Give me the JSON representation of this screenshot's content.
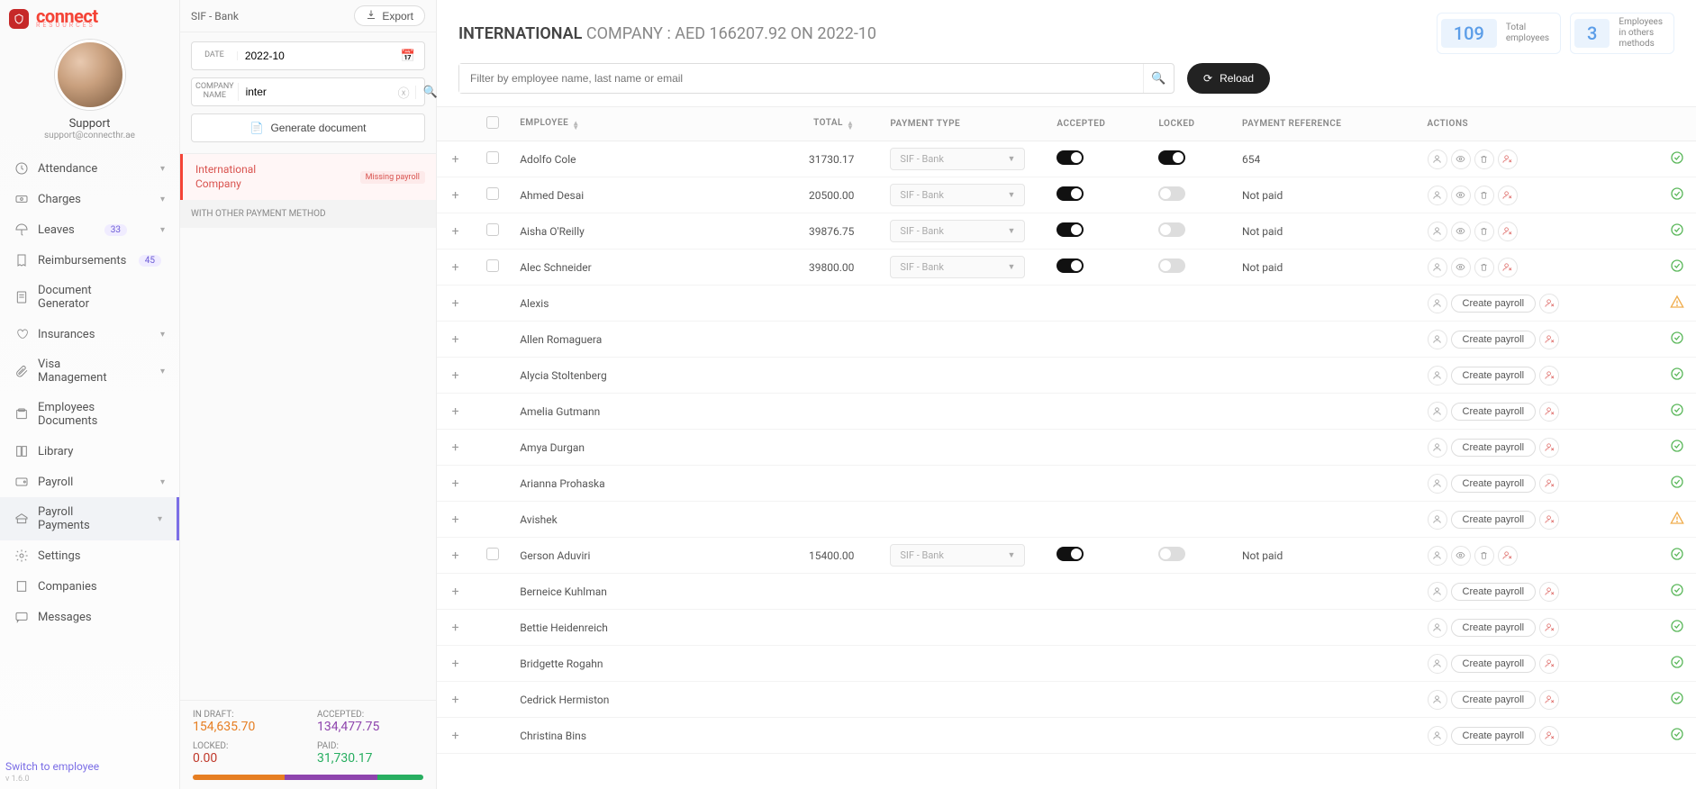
{
  "brand": {
    "name": "connect",
    "sub": "RESOURCES"
  },
  "user": {
    "name": "Support",
    "email": "support@connecthr.ae"
  },
  "nav": {
    "attendance": "Attendance",
    "charges": "Charges",
    "leaves": "Leaves",
    "leaves_badge": "33",
    "reimbursements": "Reimbursements",
    "reimb_badge": "45",
    "docgen1": "Document",
    "docgen2": "Generator",
    "insurances": "Insurances",
    "visa1": "Visa",
    "visa2": "Management",
    "empdoc1": "Employees",
    "empdoc2": "Documents",
    "library": "Library",
    "payroll": "Payroll",
    "pp1": "Payroll",
    "pp2": "Payments",
    "settings": "Settings",
    "companies": "Companies",
    "messages": "Messages"
  },
  "switch_link": "Switch to employee",
  "version": "v 1.6.0",
  "filter": {
    "title": "SIF - Bank",
    "export": "Export",
    "date_label": "DATE",
    "date_value": "2022-10",
    "company_label1": "COMPANY",
    "company_label2": "NAME",
    "company_value": "inter",
    "gen_doc": "Generate document",
    "company_card1": "International",
    "company_card2": "Company",
    "missing": "Missing payroll",
    "other_method": "WITH OTHER PAYMENT METHOD"
  },
  "footer_stats": {
    "draft_label": "IN DRAFT:",
    "draft_value": "154,635.70",
    "accepted_label": "ACCEPTED:",
    "accepted_value": "134,477.75",
    "locked_label": "LOCKED:",
    "locked_value": "0.00",
    "paid_label": "PAID:",
    "paid_value": "31,730.17"
  },
  "header": {
    "title_bold": "INTERNATIONAL",
    "title_rest": " COMPANY : AED 166207.92 ON 2022-10",
    "stat1_num": "109",
    "stat1_lbl1": "Total",
    "stat1_lbl2": "employees",
    "stat2_num": "3",
    "stat2_lbl1": "Employees",
    "stat2_lbl2": "in others",
    "stat2_lbl3": "methods"
  },
  "toolbar": {
    "search_placeholder": "Filter by employee name, last name or email",
    "reload": "Reload"
  },
  "columns": {
    "employee": "EMPLOYEE",
    "total": "TOTAL",
    "ptype": "PAYMENT TYPE",
    "accepted": "ACCEPTED",
    "locked": "LOCKED",
    "ref": "PAYMENT REFERENCE",
    "actions": "ACTIONS"
  },
  "ptype_value": "SIF - Bank",
  "not_paid": "Not paid",
  "create_payroll": "Create payroll",
  "rows": [
    {
      "name": "Adolfo Cole",
      "total": "31730.17",
      "ptype": true,
      "accepted": true,
      "locked": true,
      "ref": "654",
      "check": true,
      "mode": "full",
      "status": "ok"
    },
    {
      "name": "Ahmed Desai",
      "total": "20500.00",
      "ptype": true,
      "accepted": true,
      "locked": false,
      "ref": "Not paid",
      "check": true,
      "mode": "full",
      "status": "ok"
    },
    {
      "name": "Aisha O'Reilly",
      "total": "39876.75",
      "ptype": true,
      "accepted": true,
      "locked": false,
      "ref": "Not paid",
      "check": true,
      "mode": "full",
      "status": "ok"
    },
    {
      "name": "Alec Schneider",
      "total": "39800.00",
      "ptype": true,
      "accepted": true,
      "locked": false,
      "ref": "Not paid",
      "check": true,
      "mode": "full",
      "status": "ok"
    },
    {
      "name": "Alexis",
      "mode": "create",
      "status": "warn"
    },
    {
      "name": "Allen Romaguera",
      "mode": "create",
      "status": "ok"
    },
    {
      "name": "Alycia Stoltenberg",
      "mode": "create",
      "status": "ok"
    },
    {
      "name": "Amelia Gutmann",
      "mode": "create",
      "status": "ok"
    },
    {
      "name": "Amya Durgan",
      "mode": "create",
      "status": "ok"
    },
    {
      "name": "Arianna Prohaska",
      "mode": "create",
      "status": "ok"
    },
    {
      "name": "Avishek",
      "mode": "create",
      "status": "warn"
    },
    {
      "name": "Gerson Aduviri",
      "total": "15400.00",
      "ptype": true,
      "accepted": true,
      "locked": false,
      "ref": "Not paid",
      "check": true,
      "mode": "full",
      "status": "ok"
    },
    {
      "name": "Berneice Kuhlman",
      "mode": "create",
      "status": "ok"
    },
    {
      "name": "Bettie Heidenreich",
      "mode": "create",
      "status": "ok"
    },
    {
      "name": "Bridgette Rogahn",
      "mode": "create",
      "status": "ok"
    },
    {
      "name": "Cedrick Hermiston",
      "mode": "create",
      "status": "ok"
    },
    {
      "name": "Christina Bins",
      "mode": "create",
      "status": "ok"
    }
  ]
}
